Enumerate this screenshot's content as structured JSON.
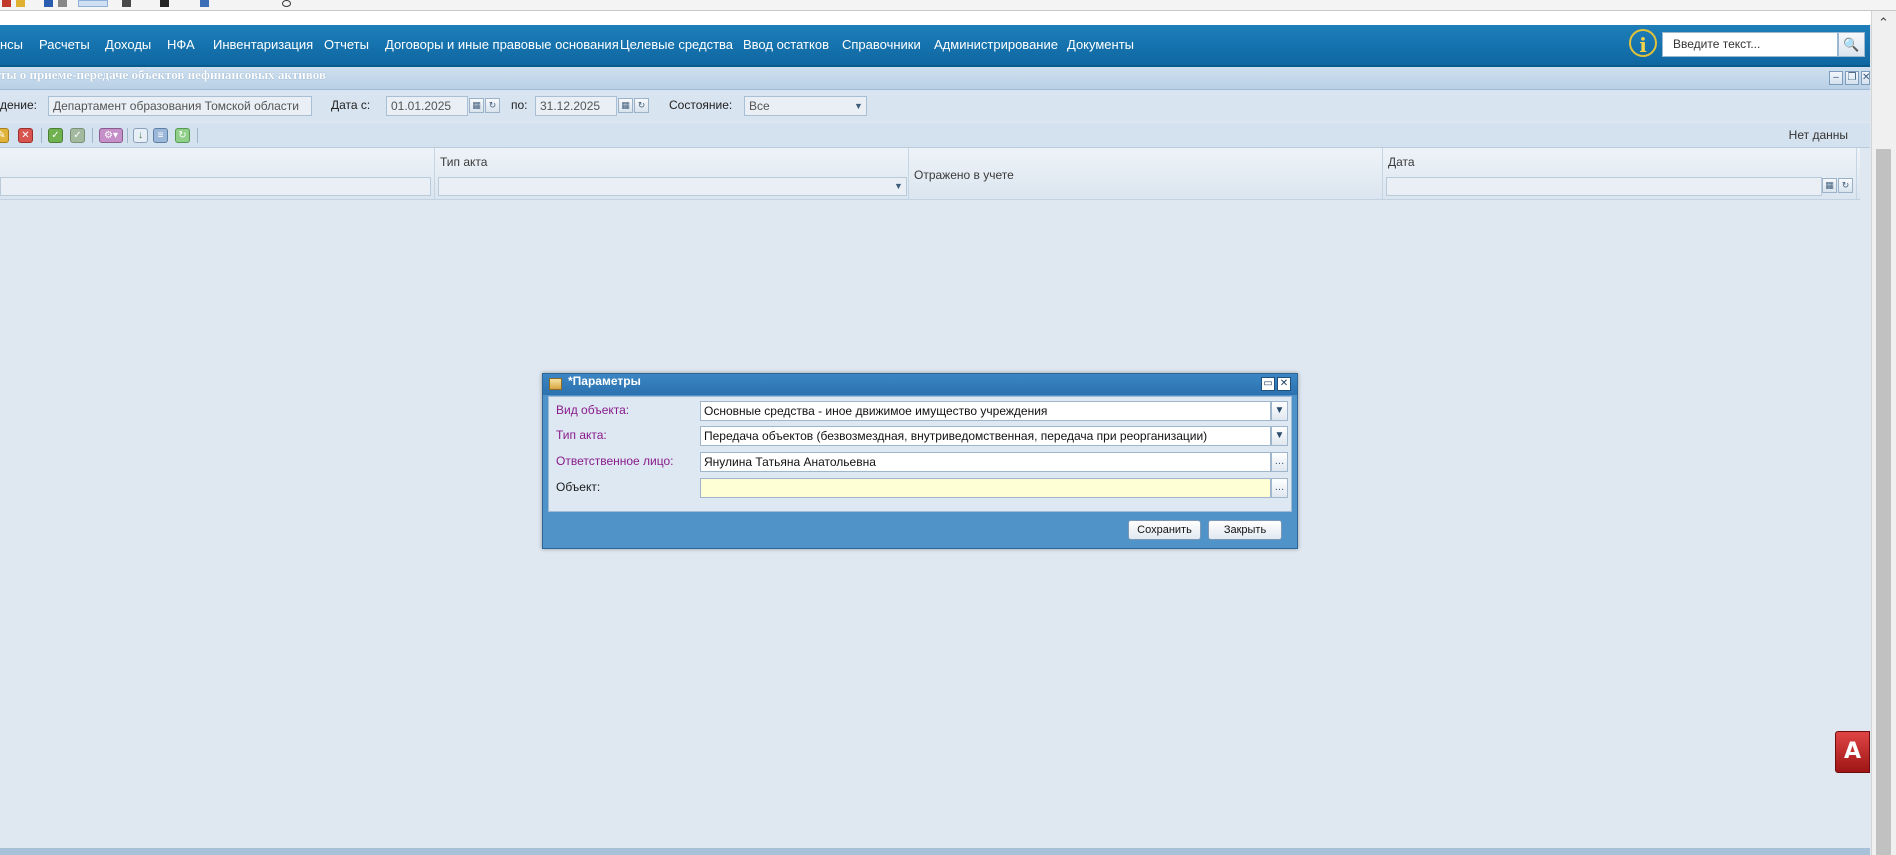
{
  "menu": {
    "items": [
      "нсы",
      "Расчеты",
      "Доходы",
      "НФА",
      "Инвентаризация",
      "Отчеты",
      "Договоры и иные правовые основания",
      "Целевые средства",
      "Ввод остатков",
      "Справочники",
      "Администрирование",
      "Документы"
    ],
    "info_icon": "i",
    "search_placeholder": "Введите текст...",
    "search_icon": "🔍"
  },
  "window": {
    "title": "ты о приеме-передаче объектов нефинансовых активов"
  },
  "filter": {
    "org_label": "дение:",
    "org_value": "Департамент образования Томской области",
    "date_from_label": "Дата с:",
    "date_from": "01.01.2025",
    "date_to_label": "по:",
    "date_to": "31.12.2025",
    "state_label": "Состояние:",
    "state_value": "Все"
  },
  "toolbar": {
    "no_data": "Нет данны"
  },
  "grid": {
    "columns": [
      "",
      "Тип акта",
      "Отражено в учете",
      "Дата"
    ]
  },
  "dialog": {
    "title": "*Параметры",
    "fields": [
      {
        "label": "Вид объекта:",
        "value": "Основные средства - иное движимое имущество учреждения"
      },
      {
        "label": "Тип акта:",
        "value": "Передача объектов (безвозмездная, внутриведомственная, передача при реорганизации)"
      },
      {
        "label": "Ответственное лицо:",
        "value": "Янулина  Татьяна Анатольевна"
      },
      {
        "label": "Объект:",
        "value": ""
      }
    ],
    "save_label": "Сохранить",
    "close_label": "Закрыть"
  },
  "colors": {
    "menu_bg": "#1775b0",
    "dialog_frame": "#4f93c9",
    "required_label": "#8a1a8a",
    "empty_field": "#ffffd6"
  },
  "icons": {
    "top_strip": [
      "flag-icon",
      "window-icon",
      "speaker-icon",
      "folder-icon",
      "document-icon",
      "magnifier-icon",
      "pen-icon",
      "chat-icon",
      "circle-icon"
    ],
    "toolbar": [
      "edit-icon",
      "delete-icon",
      "approve-icon",
      "unapprove-icon",
      "print-icon",
      "export-icon",
      "copy-icon",
      "refresh-icon"
    ],
    "side_logo": "app-logo-icon"
  }
}
